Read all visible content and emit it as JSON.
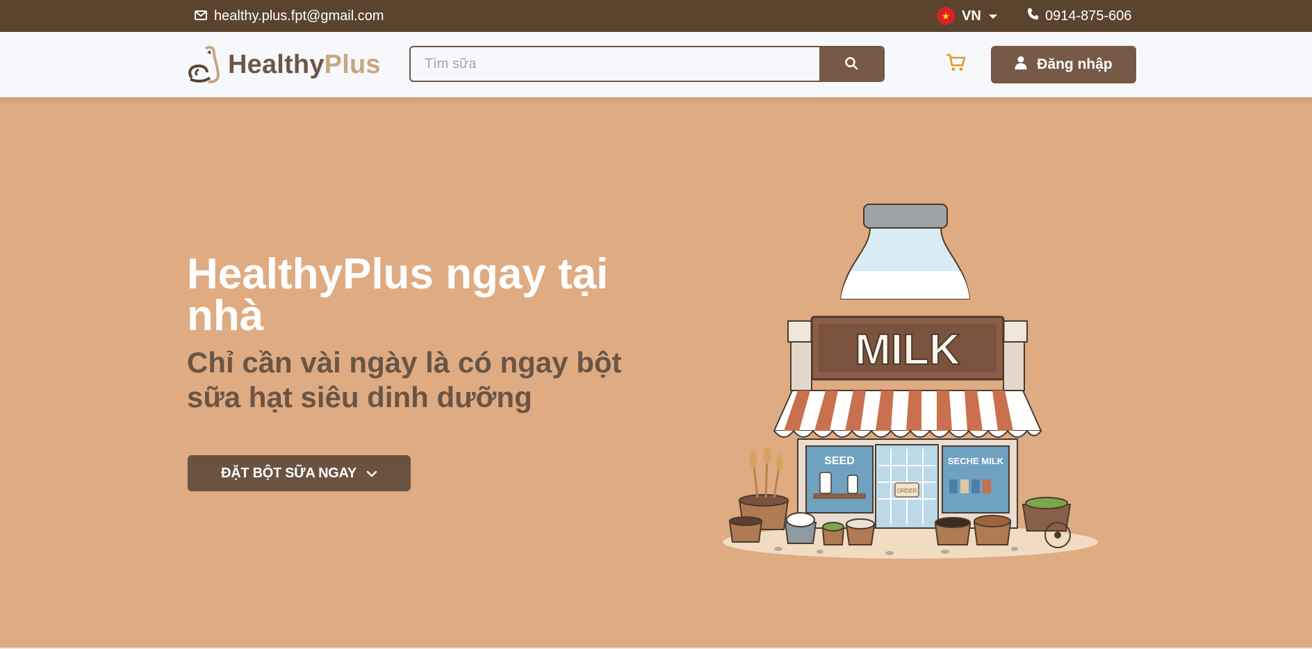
{
  "topbar": {
    "email": "healthy.plus.fpt@gmail.com",
    "email_icon": "envelope-icon",
    "language": "VN",
    "language_icon": "vietnam-flag-icon",
    "phone": "0914-875-606",
    "phone_icon": "phone-icon"
  },
  "header": {
    "logo_part1": "Healthy",
    "logo_part2": "Plus",
    "search_placeholder": "Tìm sữa",
    "search_icon": "search-icon",
    "cart_icon": "cart-icon",
    "login_label": "Đăng nhập",
    "login_icon": "user-icon"
  },
  "hero": {
    "title": "HealthyPlus ngay tại nhà",
    "subtitle": "Chỉ cần vài ngày là có ngay bột sữa hạt siêu dinh dưỡng",
    "cta_label": "ĐẶT BỘT SỮA NGAY",
    "cta_icon": "chevron-down-icon",
    "illustration_sign": "MILK",
    "window_left_text": "SEED",
    "window_right_text": "SECHE MILK",
    "door_sign": "ORDER"
  },
  "colors": {
    "topbar_bg": "#5a442e",
    "header_bg": "#f7f8fc",
    "brand_dark": "#765946",
    "brand_light": "#c7a77f",
    "hero_bg": "#dfab82",
    "cart_accent": "#e39a2a"
  }
}
